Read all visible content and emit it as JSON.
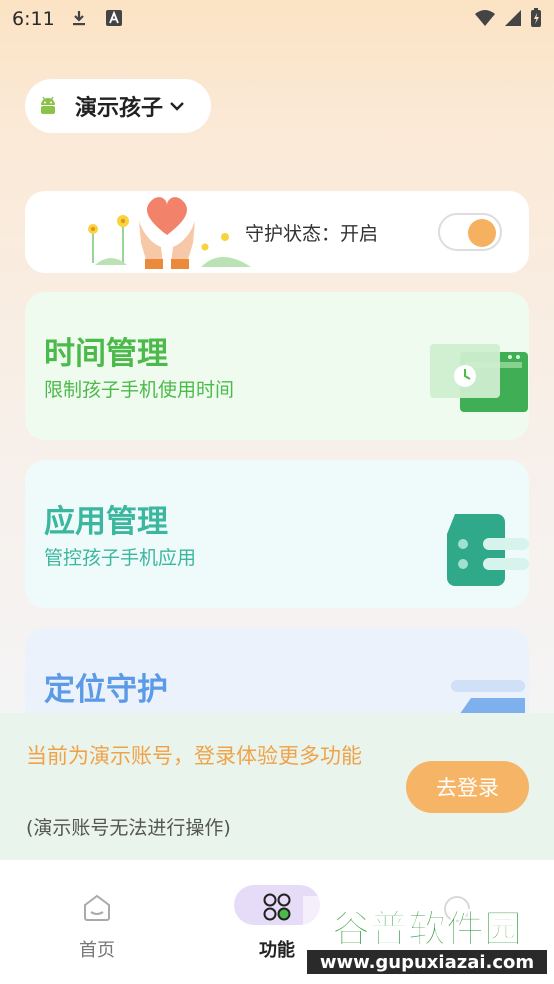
{
  "status_bar": {
    "time": "6:11"
  },
  "child_selector": {
    "name": "演示孩子"
  },
  "guard": {
    "label": "守护状态：开启",
    "enabled": true
  },
  "features": [
    {
      "title": "时间管理",
      "subtitle": "限制孩子手机使用时间",
      "color": "#4cba4a"
    },
    {
      "title": "应用管理",
      "subtitle": "管控孩子手机应用",
      "color": "#3bb79f"
    },
    {
      "title": "定位守护",
      "color": "#5b9ae6"
    }
  ],
  "demo_banner": {
    "message": "当前为演示账号，登录体验更多功能",
    "note": "(演示账号无法进行操作)",
    "login_button": "去登录"
  },
  "bottom_nav": [
    {
      "label": "首页",
      "icon": "home-icon",
      "active": false
    },
    {
      "label": "功能",
      "icon": "features-icon",
      "active": true
    }
  ],
  "watermark": {
    "brand": "谷普软件园",
    "url": "www.gupuxiazai.com"
  }
}
